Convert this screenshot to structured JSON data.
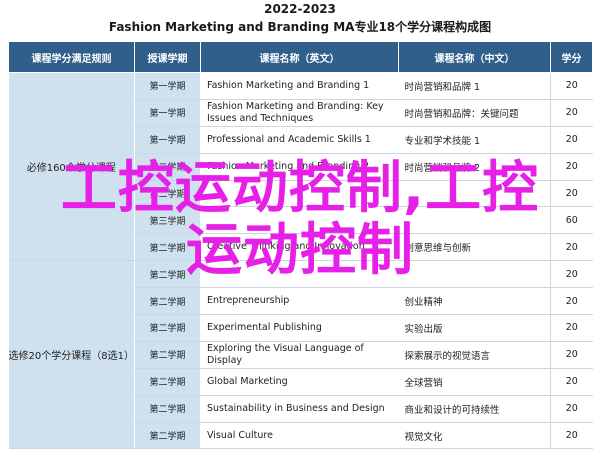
{
  "header": {
    "year": "2022-2023",
    "title": "Fashion Marketing and Branding MA专业18个学分课程构成图"
  },
  "columns": [
    "课程学分满足规则",
    "授课学期",
    "课程名称（英文）",
    "课程名称（中文）",
    "学分"
  ],
  "groups": [
    {
      "label": "必修160个学分课程",
      "rows": 7
    },
    {
      "label": "选修20个学分课程（8选1）",
      "rows": 8
    }
  ],
  "rows": [
    {
      "sem": "第一学期",
      "en": "Fashion Marketing and Branding 1",
      "zh": "时尚营销和品牌 1",
      "credits": "20"
    },
    {
      "sem": "第一学期",
      "en": "Fashion Marketing and Branding: Key Issues and Techniques",
      "zh": "时尚营销和品牌：关键问题",
      "credits": "20"
    },
    {
      "sem": "第一学期",
      "en": "Professional and Academic Skills 1",
      "zh": "专业和学术技能 1",
      "credits": "20"
    },
    {
      "sem": "第二学期",
      "en": "Fashion Marketing and Branding 2",
      "zh": "时尚营销和品牌 2",
      "credits": "20"
    },
    {
      "sem": "第二学期",
      "en": "",
      "zh": "",
      "credits": "20"
    },
    {
      "sem": "第三学期",
      "en": "",
      "zh": "",
      "credits": "60"
    },
    {
      "sem": "第二学期",
      "en": "Creative Thinking and Innovation",
      "zh": "创意思维与创新",
      "credits": "20"
    },
    {
      "sem": "第二学期",
      "en": "",
      "zh": "",
      "credits": "20"
    },
    {
      "sem": "第二学期",
      "en": "Entrepreneurship",
      "zh": "创业精神",
      "credits": "20"
    },
    {
      "sem": "第二学期",
      "en": "Experimental Publishing",
      "zh": "实验出版",
      "credits": "20"
    },
    {
      "sem": "第二学期",
      "en": "Exploring the Visual Language of Display",
      "zh": "探索展示的视觉语言",
      "credits": "20"
    },
    {
      "sem": "第二学期",
      "en": "Global Marketing",
      "zh": "全球营销",
      "credits": "20"
    },
    {
      "sem": "第二学期",
      "en": "Sustainability in Business and Design",
      "zh": "商业和设计的可持续性",
      "credits": "20"
    },
    {
      "sem": "第二学期",
      "en": "Visual Culture",
      "zh": "视觉文化",
      "credits": "20"
    }
  ],
  "overlay": {
    "line1": "工控运动控制,工控",
    "line2": "运动控制"
  }
}
